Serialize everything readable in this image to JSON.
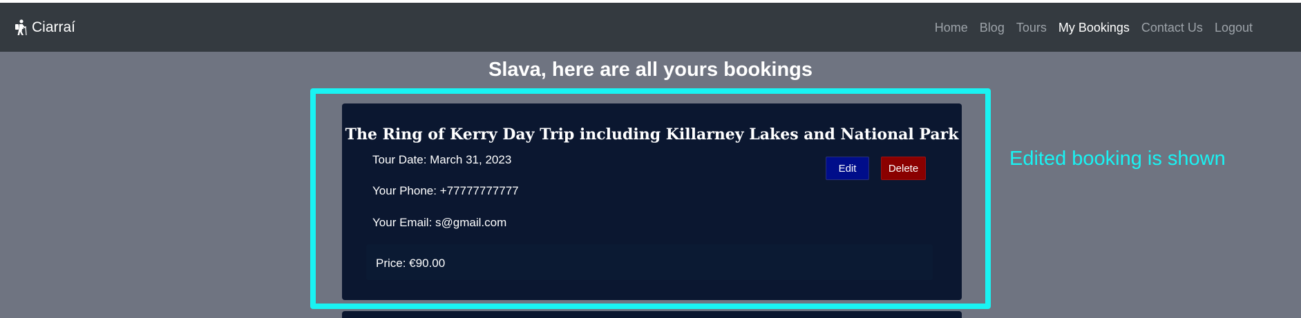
{
  "navbar": {
    "brand": "Ciarraí",
    "brand_icon": "hiker-icon",
    "links": [
      "Home",
      "Blog",
      "Tours",
      "My Bookings",
      "Contact Us",
      "Logout"
    ],
    "active": "My Bookings"
  },
  "page": {
    "heading": "Slava, here are all yours bookings"
  },
  "booking": {
    "title": "The Ring of Kerry Day Trip including Killarney Lakes and National Park",
    "tour_date": "Tour Date: March 31, 2023",
    "phone": "Your Phone: +77777777777",
    "email": "Your Email: s@gmail.com",
    "price": "Price: €90.00",
    "edit_label": "Edit",
    "delete_label": "Delete"
  },
  "annotation": {
    "text": "Edited booking is shown",
    "color": "#19f3f3"
  },
  "colors": {
    "navbar": "#343a40",
    "page_bg": "#6f7481",
    "card_bg": "#0b1730",
    "edit_button": "#000d8a",
    "delete_button": "#8a0000"
  }
}
